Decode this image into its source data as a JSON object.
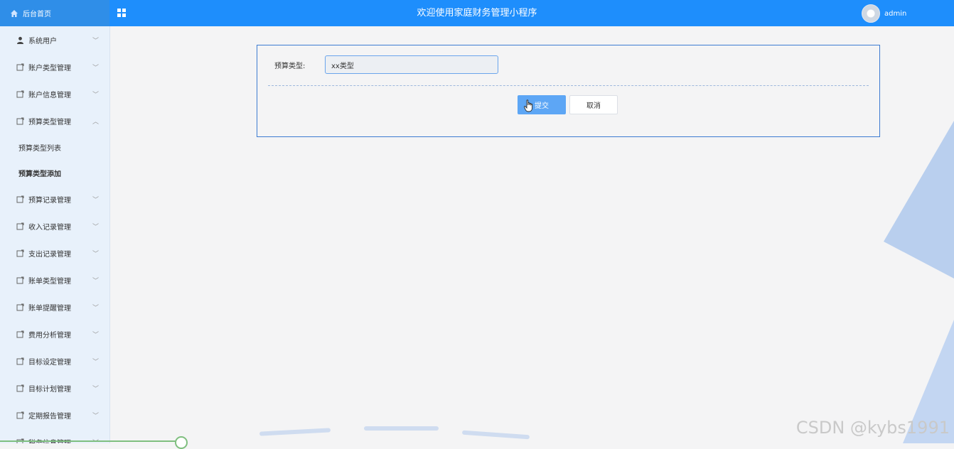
{
  "header": {
    "home_label": "后台首页",
    "app_title": "欢迎使用家庭财务管理小程序",
    "user_name": "admin",
    "accent_color": "#1e8efc"
  },
  "sidebar": {
    "items": [
      {
        "label": "系统用户",
        "icon": "user-icon",
        "expanded": false
      },
      {
        "label": "账户类型管理",
        "icon": "folder-icon",
        "expanded": false
      },
      {
        "label": "账户信息管理",
        "icon": "folder-icon",
        "expanded": false
      },
      {
        "label": "预算类型管理",
        "icon": "folder-icon",
        "expanded": true
      },
      {
        "label": "预算记录管理",
        "icon": "folder-icon",
        "expanded": false
      },
      {
        "label": "收入记录管理",
        "icon": "folder-icon",
        "expanded": false
      },
      {
        "label": "支出记录管理",
        "icon": "folder-icon",
        "expanded": false
      },
      {
        "label": "账单类型管理",
        "icon": "folder-icon",
        "expanded": false
      },
      {
        "label": "账单提醒管理",
        "icon": "folder-icon",
        "expanded": false
      },
      {
        "label": "费用分析管理",
        "icon": "folder-icon",
        "expanded": false
      },
      {
        "label": "目标设定管理",
        "icon": "folder-icon",
        "expanded": false
      },
      {
        "label": "目标计划管理",
        "icon": "folder-icon",
        "expanded": false
      },
      {
        "label": "定期报告管理",
        "icon": "folder-icon",
        "expanded": false
      },
      {
        "label": "税务信息管理",
        "icon": "folder-icon",
        "expanded": false
      }
    ],
    "subitems": [
      {
        "label": "预算类型列表",
        "active": false
      },
      {
        "label": "预算类型添加",
        "active": true
      }
    ]
  },
  "form": {
    "label": "预算类型:",
    "value": "xx类型",
    "submit_label": "提交",
    "cancel_label": "取消"
  },
  "watermark": "CSDN @kybs1991"
}
